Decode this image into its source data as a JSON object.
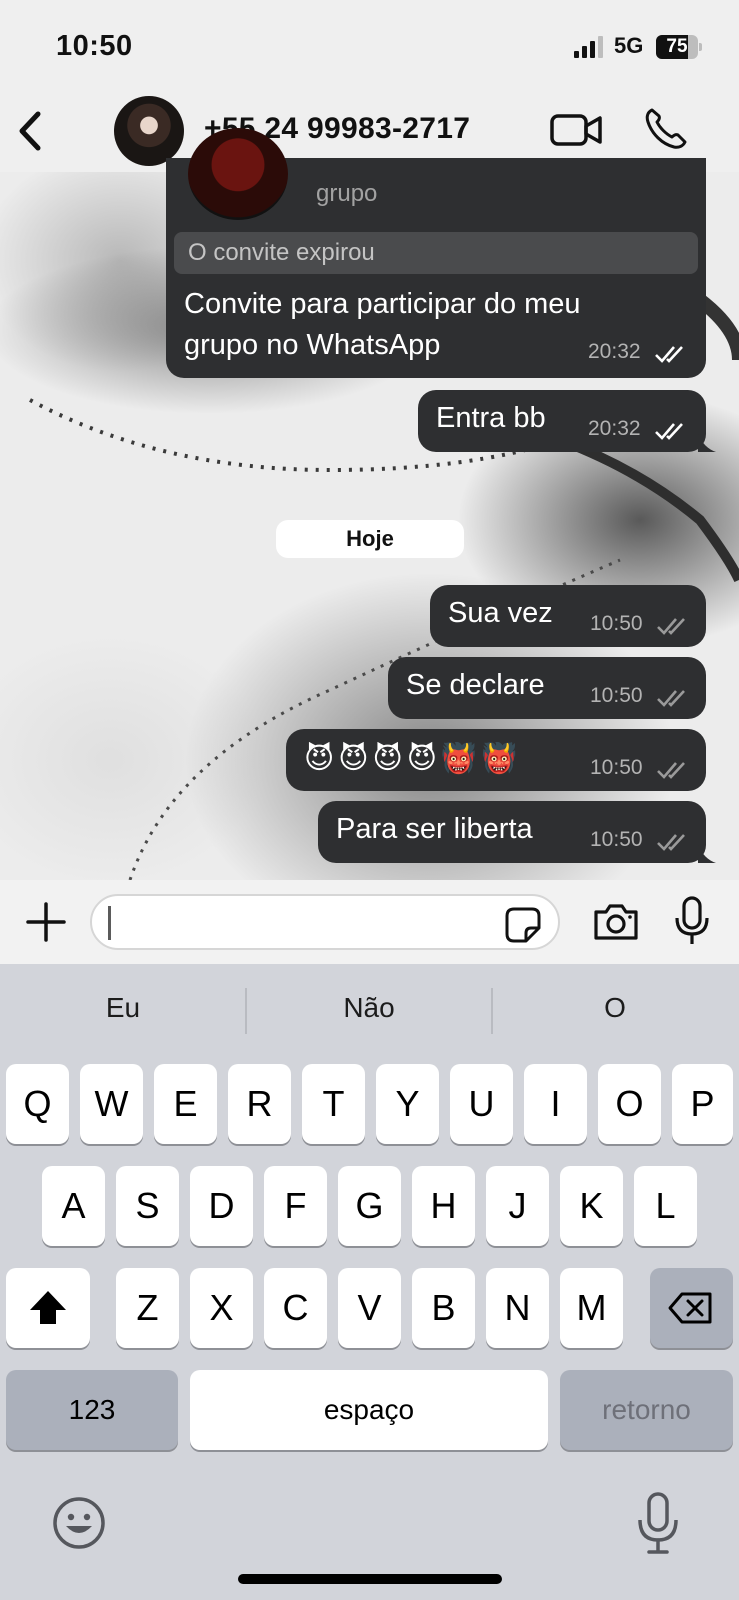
{
  "status_bar": {
    "time": "10:50",
    "network": "5G",
    "battery": "75",
    "battery_fraction": 0.75
  },
  "header": {
    "contact_name": "+55 24 99983-2717"
  },
  "invite": {
    "group_label": "grupo",
    "expired_label": "O convite expirou",
    "text": "Convite para participar do meu grupo no WhatsApp",
    "time": "20:32"
  },
  "messages_yesterday": [
    {
      "text": "Entra bb",
      "time": "20:32"
    }
  ],
  "date_separator": "Hoje",
  "messages_today": [
    {
      "text": "Sua vez",
      "time": "10:50"
    },
    {
      "text": "Se declare",
      "time": "10:50"
    },
    {
      "text": "😈😈😈😈👹👹",
      "time": "10:50"
    },
    {
      "text": "Para ser liberta",
      "time": "10:50"
    }
  ],
  "keyboard": {
    "suggestions": [
      "Eu",
      "Não",
      "O"
    ],
    "row1": [
      "Q",
      "W",
      "E",
      "R",
      "T",
      "Y",
      "U",
      "I",
      "O",
      "P"
    ],
    "row2": [
      "A",
      "S",
      "D",
      "F",
      "G",
      "H",
      "J",
      "K",
      "L"
    ],
    "row3": [
      "Z",
      "X",
      "C",
      "V",
      "B",
      "N",
      "M"
    ],
    "numbers_key": "123",
    "space_key": "espaço",
    "return_key": "retorno"
  },
  "colors": {
    "bubble": "#2e2f31",
    "keyboard_bg": "#d2d4da"
  }
}
